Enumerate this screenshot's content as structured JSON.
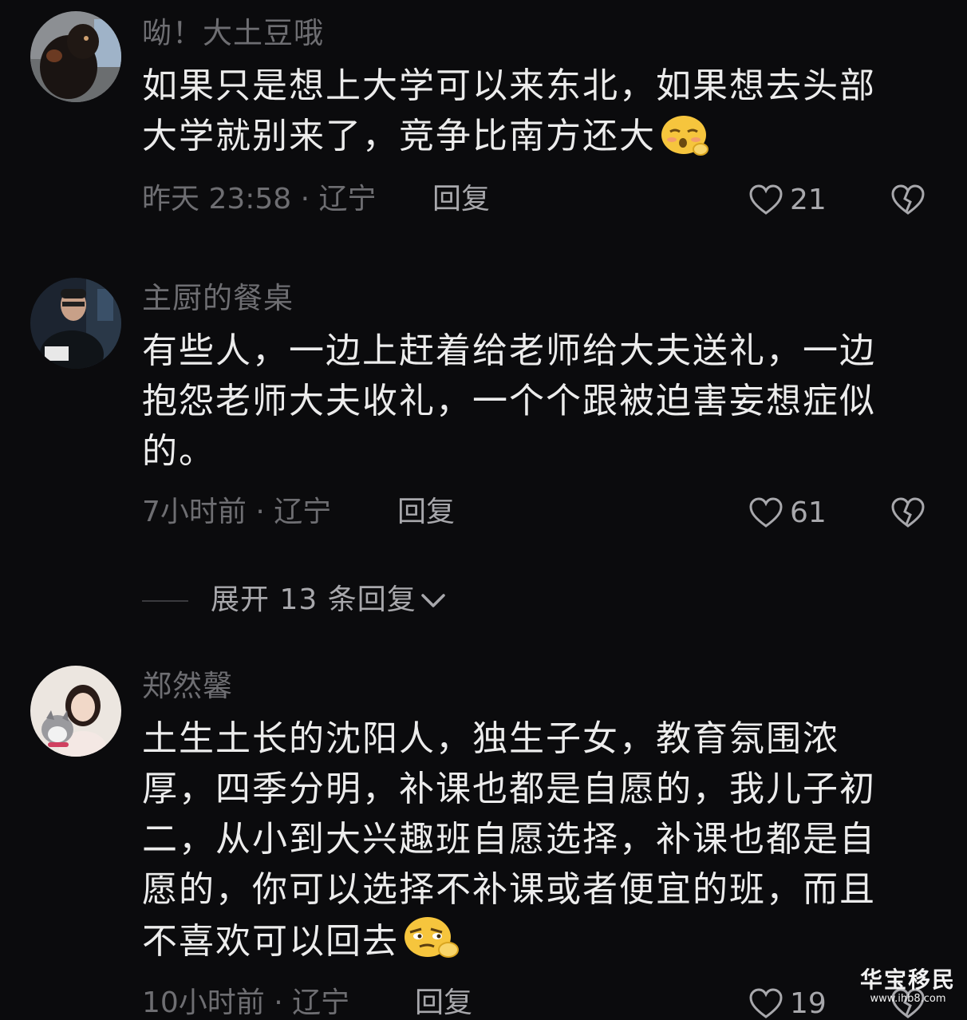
{
  "comments": [
    {
      "username": "呦！大土豆哦",
      "lines": [
        "如果只是想上大学可以来东北，如果想去头部",
        "大学就别来了，竞争比南方还大"
      ],
      "emoji": "sleepy-face-emoji",
      "time_location": "昨天 23:58 · 辽宁",
      "reply_label": "回复",
      "likes": "21"
    },
    {
      "username": "主厨的餐桌",
      "lines": [
        "有些人，一边上赶着给老师给大夫送礼，一边",
        "抱怨老师大夫收礼，一个个跟被迫害妄想症似",
        "的。"
      ],
      "time_location": "7小时前 · 辽宁",
      "reply_label": "回复",
      "likes": "61"
    },
    {
      "username": "郑然馨",
      "lines": [
        "土生土长的沈阳人，独生子女，教育氛围浓",
        "厚，四季分明，补课也都是自愿的，我儿子初",
        "二，从小到大兴趣班自愿选择，补课也都是自",
        "愿的，你可以选择不补课或者便宜的班，而且",
        "不喜欢可以回去"
      ],
      "emoji": "smirk-face-emoji",
      "time_location": "10小时前 · 辽宁",
      "reply_label": "回复",
      "likes": "19"
    }
  ],
  "expand_replies": "展开 13 条回复",
  "watermark": {
    "brand": "华宝移民",
    "url": "www.ihb8.com"
  },
  "colors": {
    "background": "#0b0b0d",
    "text_primary": "#ececec",
    "text_secondary": "#6e6e72",
    "text_action": "#a8a8ac"
  }
}
